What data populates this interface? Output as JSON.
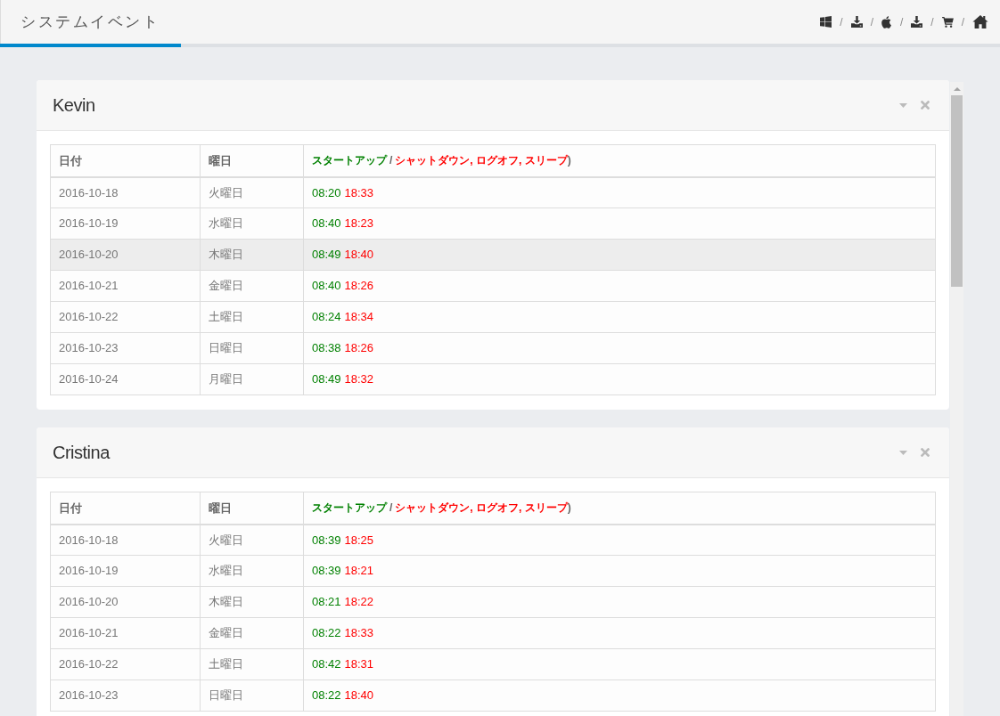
{
  "header": {
    "title": "システムイベント"
  },
  "toolbar": [
    {
      "kind": "windows",
      "separator": "/"
    },
    {
      "kind": "download",
      "separator": "/"
    },
    {
      "kind": "apple",
      "separator": "/"
    },
    {
      "kind": "download",
      "separator": "/"
    },
    {
      "kind": "cart",
      "separator": "/"
    },
    {
      "kind": "home"
    }
  ],
  "panels": [
    {
      "title": "Kevin",
      "table": {
        "columns": [
          {
            "label": "日付"
          },
          {
            "label": "曜日"
          },
          {
            "parts": [
              {
                "kind": "startup",
                "text": "スタートアップ"
              },
              {
                "kind": "plain",
                "text": "/"
              },
              {
                "kind": "shutdown",
                "text": "シャットダウン, ログオフ, スリープ"
              },
              {
                "kind": "plain",
                "text": ")"
              }
            ]
          }
        ],
        "rows": [
          {
            "date": "2016-10-18",
            "weekday": "火曜日",
            "startup": "08:20",
            "shutdown": "18:33",
            "hovered": false
          },
          {
            "date": "2016-10-19",
            "weekday": "水曜日",
            "startup": "08:40",
            "shutdown": "18:23",
            "hovered": false
          },
          {
            "date": "2016-10-20",
            "weekday": "木曜日",
            "startup": "08:49",
            "shutdown": "18:40",
            "hovered": true
          },
          {
            "date": "2016-10-21",
            "weekday": "金曜日",
            "startup": "08:40",
            "shutdown": "18:26",
            "hovered": false
          },
          {
            "date": "2016-10-22",
            "weekday": "土曜日",
            "startup": "08:24",
            "shutdown": "18:34",
            "hovered": false
          },
          {
            "date": "2016-10-23",
            "weekday": "日曜日",
            "startup": "08:38",
            "shutdown": "18:26",
            "hovered": false
          },
          {
            "date": "2016-10-24",
            "weekday": "月曜日",
            "startup": "08:49",
            "shutdown": "18:32",
            "hovered": false
          }
        ]
      }
    },
    {
      "title": "Cristina",
      "table": {
        "columns": [
          {
            "label": "日付"
          },
          {
            "label": "曜日"
          },
          {
            "parts": [
              {
                "kind": "startup",
                "text": "スタートアップ"
              },
              {
                "kind": "plain",
                "text": "/"
              },
              {
                "kind": "shutdown",
                "text": "シャットダウン, ログオフ, スリープ"
              },
              {
                "kind": "plain",
                "text": ")"
              }
            ]
          }
        ],
        "rows": [
          {
            "date": "2016-10-18",
            "weekday": "火曜日",
            "startup": "08:39",
            "shutdown": "18:25",
            "hovered": false
          },
          {
            "date": "2016-10-19",
            "weekday": "水曜日",
            "startup": "08:39",
            "shutdown": "18:21",
            "hovered": false
          },
          {
            "date": "2016-10-20",
            "weekday": "木曜日",
            "startup": "08:21",
            "shutdown": "18:22",
            "hovered": false
          },
          {
            "date": "2016-10-21",
            "weekday": "金曜日",
            "startup": "08:22",
            "shutdown": "18:33",
            "hovered": false
          },
          {
            "date": "2016-10-22",
            "weekday": "土曜日",
            "startup": "08:42",
            "shutdown": "18:31",
            "hovered": false
          },
          {
            "date": "2016-10-23",
            "weekday": "日曜日",
            "startup": "08:22",
            "shutdown": "18:40",
            "hovered": false
          }
        ]
      }
    }
  ]
}
